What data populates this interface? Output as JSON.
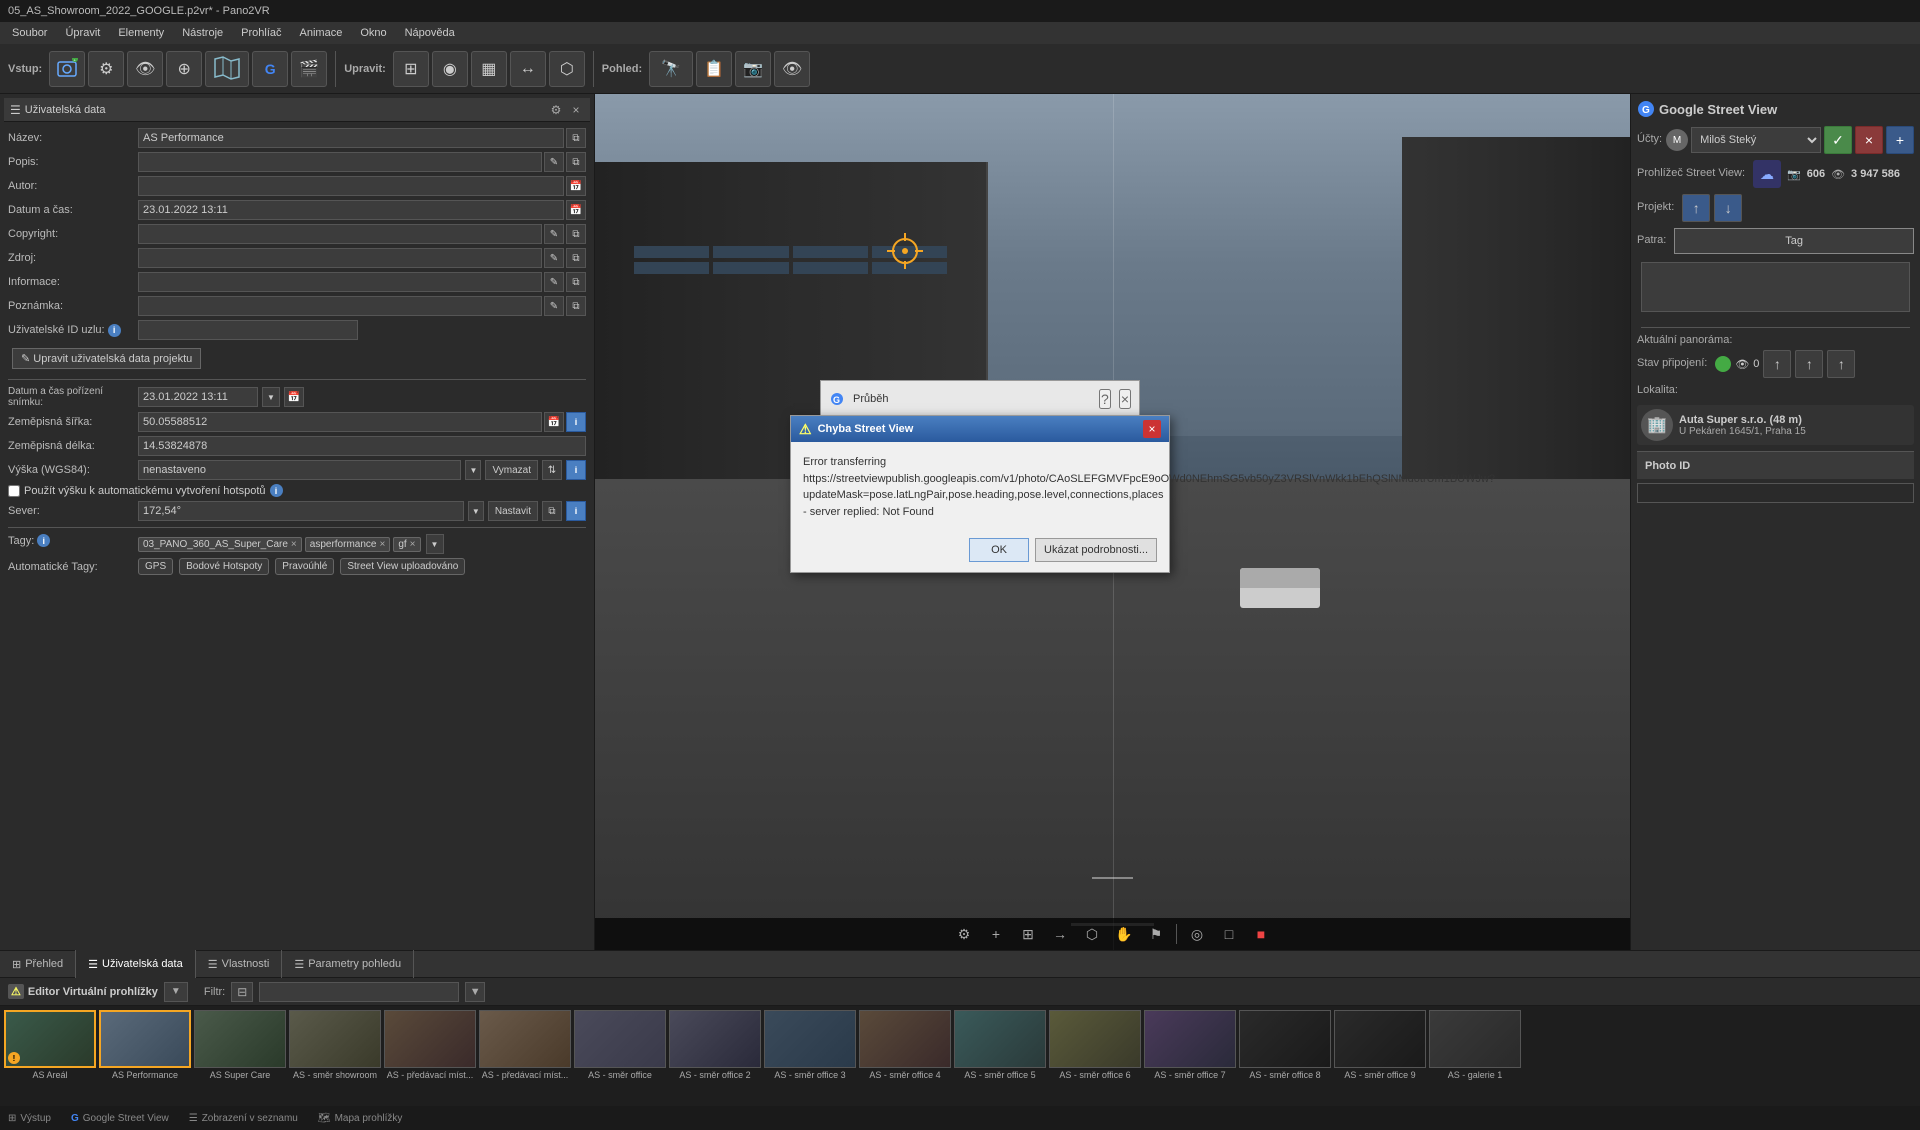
{
  "titlebar": {
    "text": "05_AS_Showroom_2022_GOOGLE.p2vr* - Pano2VR"
  },
  "menubar": {
    "items": [
      "Soubor",
      "Úpravit",
      "Elementy",
      "Nástroje",
      "Prohlíač",
      "Animace",
      "Okno",
      "Nápověda"
    ]
  },
  "toolbar": {
    "vstup_label": "Vstup:",
    "upravit_label": "Upravit:",
    "pohled_label": "Pohled:"
  },
  "left_panel": {
    "title": "Uživatelská data",
    "fields": {
      "nazev_label": "Název:",
      "nazev_value": "AS Performance",
      "popis_label": "Popis:",
      "autor_label": "Autor:",
      "datum_label": "Datum a čas:",
      "datum_value": "23.01.2022 13:11",
      "copyright_label": "Copyright:",
      "zdroj_label": "Zdroj:",
      "informace_label": "Informace:",
      "poznamka_label": "Poznámka:",
      "user_id_label": "Uživatelské ID uzlu:",
      "edit_btn": "✎ Upravit uživatelská data projektu",
      "datetime_label": "Datum a čas pořízení snímku:",
      "datetime_value": "23.01.2022 13:11",
      "sirka_label": "Zeměpisná šířka:",
      "sirka_value": "50.05588512",
      "delka_label": "Zeměpisná délka:",
      "delka_value": "14.53824878",
      "vyska_label": "Výška (WGS84):",
      "vyska_value": "nenastaveno",
      "vyska_btn": "Vymazat",
      "sever_label": "Sever:",
      "sever_value": "172,54°",
      "sever_btn": "Nastavit",
      "tagy_label": "Tagy:",
      "tag1": "03_PANO_360_AS_Super_Care",
      "tag2": "asperformance",
      "tag3": "gf",
      "auto_tagy_label": "Automatické Tagy:",
      "auto_tag1": "GPS",
      "auto_tag2": "Bodové Hotspoty",
      "auto_tag3": "Pravoúhlé",
      "auto_tag4": "Street View uploadováno"
    }
  },
  "panorama": {
    "crosshair": "⊕"
  },
  "right_panel": {
    "title": "Google Street View",
    "ucty_label": "Účty:",
    "user_name": "Miloš Steký",
    "prohlizec_label": "Prohlížeč Street View:",
    "photo_count": "606",
    "view_count": "3 947 586",
    "projekt_label": "Projekt:",
    "patra_label": "Patra:",
    "tag_btn": "Tag",
    "aktualni_label": "Aktuální panoráma:",
    "stav_label": "Stav připojení:",
    "stav_count": "0",
    "lokalita_label": "Lokalita:",
    "location_name": "Auta Super s.r.o. (48 m)",
    "location_addr": "U Pekáren 1645/1, Praha 15",
    "photo_id_label": "Photo ID"
  },
  "bottom_tabs": [
    {
      "label": "Přehled",
      "icon": "⊞",
      "active": false
    },
    {
      "label": "Uživatelská data",
      "icon": "☰",
      "active": true
    },
    {
      "label": "Vlastnosti",
      "icon": "☰",
      "active": false
    },
    {
      "label": "Parametry pohledu",
      "icon": "☰",
      "active": false
    }
  ],
  "status_bar_bottom": {
    "items": [
      "Výstup",
      "Google Street View",
      "Zobrazení v seznamu",
      "Mapa prohlížky"
    ]
  },
  "virtual_editor": {
    "label": "Editor Virtuální prohlížky",
    "filter_label": "Filtr:"
  },
  "thumbnails": [
    {
      "label": "AS Areál",
      "type": "exterior",
      "active": false
    },
    {
      "label": "AS Performance",
      "type": "exterior",
      "active": true
    },
    {
      "label": "AS Super Care",
      "type": "exterior",
      "active": false
    },
    {
      "label": "AS - směr showroom",
      "type": "exterior",
      "active": false
    },
    {
      "label": "AS - předávací míst...",
      "type": "interior",
      "active": false
    },
    {
      "label": "AS - předávací míst...",
      "type": "interior",
      "active": false
    },
    {
      "label": "AS - směr office",
      "type": "interior",
      "active": false
    },
    {
      "label": "AS - směr office 2",
      "type": "interior",
      "active": false
    },
    {
      "label": "AS - směr office 3",
      "type": "interior",
      "active": false
    },
    {
      "label": "AS - směr office 4",
      "type": "interior",
      "active": false
    },
    {
      "label": "AS - směr office 5",
      "type": "interior",
      "active": false
    },
    {
      "label": "AS - směr office 6",
      "type": "interior",
      "active": false
    },
    {
      "label": "AS - směr office 7",
      "type": "interior",
      "active": false
    },
    {
      "label": "AS - směr office 8",
      "type": "interior",
      "active": false
    },
    {
      "label": "AS - směr office 9",
      "type": "interior",
      "active": false
    },
    {
      "label": "AS - galerie 1",
      "type": "interior",
      "active": false
    }
  ],
  "progress_dialog": {
    "title": "Průběh",
    "help": "?",
    "close": "×"
  },
  "error_dialog": {
    "title": "Chyba Street View",
    "close": "×",
    "message": "Error transferring https://streetviewpublish.googleapis.com/v1/photo/CAoSLEFGMVFpcE9oOWd0NEhmSG5vb50yZ3VRSlVnWkk1bEhQSlNMd0trUm1BUWJw?updateMask=pose.latLngPair,pose.heading,pose.level,connections,places - server replied: Not Found",
    "ok_btn": "OK",
    "details_btn": "Ukázat podrobnosti..."
  }
}
